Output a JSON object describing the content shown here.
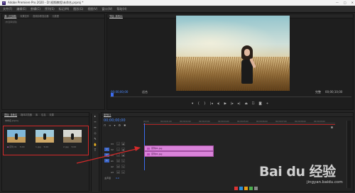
{
  "window": {
    "title": "Adobe Premiere Pro 2020 - D:\\视频教程\\未命名.prproj *",
    "logo": "Pr",
    "controls": [
      "—",
      "□",
      "✕"
    ]
  },
  "menu": [
    "文件(F)",
    "编辑(E)",
    "剪辑(C)",
    "序列(S)",
    "标记(M)",
    "图形(G)",
    "视图(V)",
    "窗口(W)",
    "帮助(H)"
  ],
  "source_panel": {
    "tabs": [
      "源: (无剪辑)",
      "效果控件",
      "音频剪辑混合器",
      "元数据"
    ],
    "empty_text": "(未选择剪辑)"
  },
  "program_panel": {
    "tab": "节目: 序列01",
    "timecode_left": "00;00;00;00",
    "fit_label": "适合",
    "quality_label": "完整",
    "timecode_right": "00;00;10;00",
    "transport_icons": [
      "marker-icon",
      "in-point-icon",
      "out-point-icon",
      "go-to-in-icon",
      "step-back-icon",
      "play-icon",
      "step-forward-icon",
      "go-to-out-icon",
      "lift-icon",
      "extract-icon",
      "export-frame-icon",
      "plus-icon"
    ],
    "transport_glyphs": [
      "▾",
      "{",
      "}",
      "|◂",
      "◂|",
      "▶",
      "|▸",
      "▸|",
      "⏏",
      "⏍",
      "◙",
      "+"
    ]
  },
  "project_panel": {
    "tabs": [
      "项目: 未命名",
      "媒体浏览器",
      "库",
      "信息",
      "效果",
      "标记",
      "历史记录"
    ],
    "path": "未命名.prproj",
    "items": [
      {
        "name": "序列 01",
        "duration": "5;00",
        "colors": [
          "#7fb7d9",
          "#c19a5a"
        ]
      },
      {
        "name": "1.jpg",
        "duration": "5;00",
        "colors": [
          "#9fc9da",
          "#cfa968"
        ]
      },
      {
        "name": "2.jpg",
        "duration": "5;00",
        "colors": [
          "#d6d7d2",
          "#8f7a5a"
        ]
      }
    ]
  },
  "timeline": {
    "tab": "序列01",
    "timecode": "00;00;00;00",
    "ruler": [
      "00;00",
      "00;00;01;00",
      "00;00;02;00",
      "00;00;03;00",
      "00;00;04;00",
      "00;00;05;00",
      "00;00;06;00",
      "00;00;07;00",
      "00;00;08;00",
      "00;00;09;00"
    ],
    "video_tracks": [
      "V3",
      "V2",
      "V1"
    ],
    "audio_tracks": [
      "A1",
      "A2",
      "A3"
    ],
    "master": "主声道",
    "master_value": "0.0",
    "clips": [
      {
        "label": "序列01.jpg",
        "track": "V2"
      },
      {
        "label": "序列01.jpg",
        "track": "V1"
      }
    ]
  },
  "tools": [
    "▸",
    "⇿",
    "↔",
    "◇",
    "✎",
    "✋",
    "T"
  ],
  "watermark": {
    "text": "Bai du 经验",
    "sub": "jingyan.baidu.com"
  },
  "colors": {
    "accent_blue": "#3c6cf0",
    "clip_pink": "#d983d9",
    "highlight_red": "#d42a2a"
  }
}
